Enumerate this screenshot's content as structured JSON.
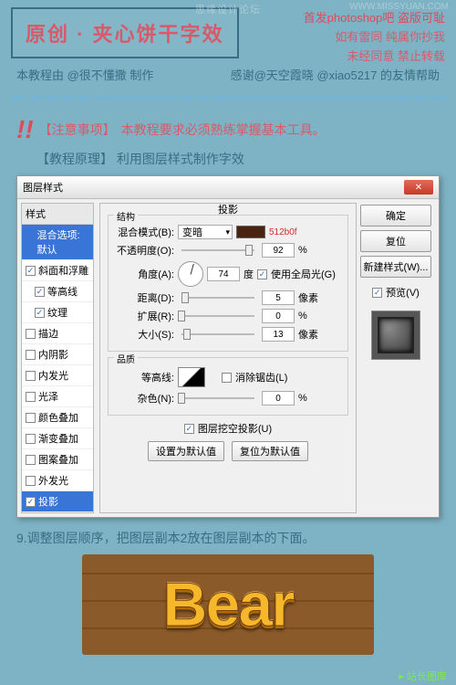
{
  "header": {
    "watermark_center": "思缘设计论坛",
    "watermark_right": "WWW.MISSYUAN.COM",
    "title": "原创 · 夹心饼干字效",
    "right_line1": "首发photoshop吧  盗版可耻",
    "right_line2": "如有雷同 纯属你抄我",
    "right_line3": "未经同意 禁止转载",
    "credit_left": "本教程由 @很不懂撒 制作",
    "credit_right": "感谢@天空霞晓 @xiao5217 的友情帮助"
  },
  "notice": {
    "exclaim": "!!",
    "attention_label": "【注意事项】",
    "attention_text": "本教程要求必须熟练掌握基本工具。",
    "principle_label": "【教程原理】",
    "principle_text": "利用图层样式制作字效"
  },
  "dialog": {
    "title": "图层样式",
    "close": "✕",
    "styles_header": "样式",
    "styles": [
      {
        "label": "混合选项:默认",
        "checked": false,
        "sel": true
      },
      {
        "label": "斜面和浮雕",
        "checked": true,
        "emph": true
      },
      {
        "label": "等高线",
        "checked": true,
        "indent": true
      },
      {
        "label": "纹理",
        "checked": true,
        "indent": true
      },
      {
        "label": "描边",
        "checked": false
      },
      {
        "label": "内阴影",
        "checked": false
      },
      {
        "label": "内发光",
        "checked": false
      },
      {
        "label": "光泽",
        "checked": false
      },
      {
        "label": "颜色叠加",
        "checked": false
      },
      {
        "label": "渐变叠加",
        "checked": false
      },
      {
        "label": "图案叠加",
        "checked": false
      },
      {
        "label": "外发光",
        "checked": false
      },
      {
        "label": "投影",
        "checked": true,
        "sel": true
      }
    ],
    "panel_title": "投影",
    "structure_title": "结构",
    "blend_mode_label": "混合模式(B):",
    "blend_mode_value": "变暗",
    "color_hex": "512b0f",
    "opacity_label": "不透明度(O):",
    "opacity_value": "92",
    "opacity_unit": "%",
    "angle_label": "角度(A):",
    "angle_value": "74",
    "angle_unit": "度",
    "global_light_label": "使用全局光(G)",
    "distance_label": "距离(D):",
    "distance_value": "5",
    "distance_unit": "像素",
    "spread_label": "扩展(R):",
    "spread_value": "0",
    "spread_unit": "%",
    "size_label": "大小(S):",
    "size_value": "13",
    "size_unit": "像素",
    "quality_title": "品质",
    "contour_label": "等高线:",
    "antialias_label": "消除锯齿(L)",
    "noise_label": "杂色(N):",
    "noise_value": "0",
    "noise_unit": "%",
    "knockout_label": "图层挖空投影(U)",
    "make_default": "设置为默认值",
    "reset_default": "复位为默认值",
    "right_buttons": {
      "ok": "确定",
      "cancel": "复位",
      "new_style": "新建样式(W)...",
      "preview_label": "预览(V)"
    }
  },
  "step": "9.调整图层顺序，把图层副本2放在图层副本的下面。",
  "result_text": "Bear",
  "footer": "站长图库"
}
